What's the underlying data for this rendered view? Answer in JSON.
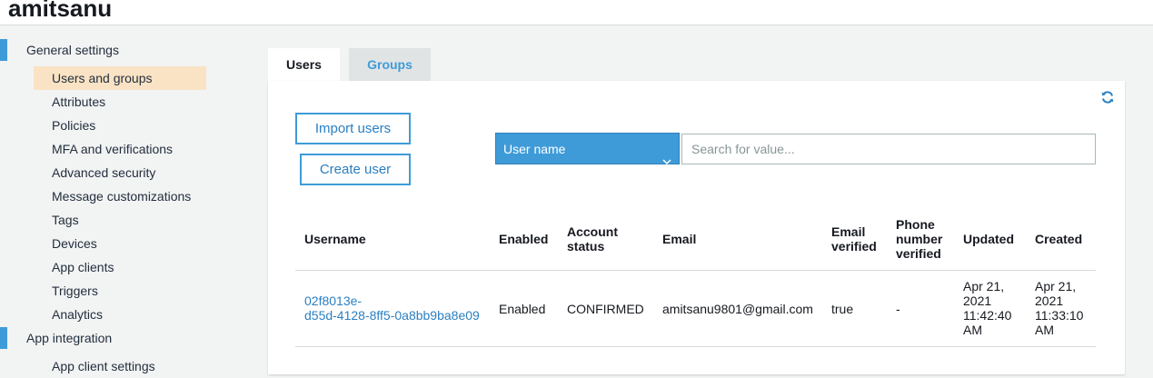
{
  "header": {
    "title": "amitsanu"
  },
  "sidebar": {
    "general_settings": "General settings",
    "items": [
      {
        "label": "Users and groups"
      },
      {
        "label": "Attributes"
      },
      {
        "label": "Policies"
      },
      {
        "label": "MFA and verifications"
      },
      {
        "label": "Advanced security"
      },
      {
        "label": "Message customizations"
      },
      {
        "label": "Tags"
      },
      {
        "label": "Devices"
      },
      {
        "label": "App clients"
      },
      {
        "label": "Triggers"
      },
      {
        "label": "Analytics"
      }
    ],
    "app_integration": "App integration",
    "app_items": [
      {
        "label": "App client settings"
      }
    ]
  },
  "tabs": {
    "users": "Users",
    "groups": "Groups"
  },
  "toolbar": {
    "import_label": "Import users",
    "create_label": "Create user",
    "filter_selected": "User name",
    "search_placeholder": "Search for value..."
  },
  "table": {
    "columns": {
      "username": "Username",
      "enabled": "Enabled",
      "account_status": [
        "Account",
        "status"
      ],
      "email": "Email",
      "email_verified": [
        "Email",
        "verified"
      ],
      "phone_verified": [
        "Phone",
        "number",
        "verified"
      ],
      "updated": "Updated",
      "created": "Created"
    },
    "rows": [
      {
        "username": [
          "02f8013e-",
          "d55d-4128-8ff5-0a8bb9ba8e09"
        ],
        "enabled": "Enabled",
        "account_status": "CONFIRMED",
        "email": "amitsanu9801@gmail.com",
        "email_verified": "true",
        "phone_verified": "-",
        "updated": [
          "Apr 21,",
          "2021",
          "11:42:40",
          "AM"
        ],
        "created": [
          "Apr 21,",
          "2021",
          "11:33:10",
          "AM"
        ]
      }
    ]
  },
  "colors": {
    "accent": "#3f9bd8",
    "link": "#2a7fc1",
    "active_nav": "#fae3c4"
  },
  "icons": {
    "refresh": "refresh-icon",
    "dropdown": "chevron-down-icon"
  }
}
